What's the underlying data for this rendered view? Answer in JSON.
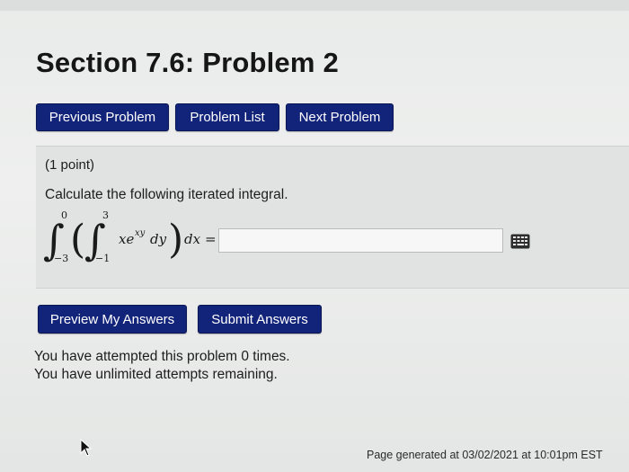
{
  "page": {
    "title": "Section 7.6: Problem 2"
  },
  "nav": {
    "previous": "Previous Problem",
    "list": "Problem List",
    "next": "Next Problem"
  },
  "problem": {
    "points": "(1 point)",
    "prompt": "Calculate the following iterated integral.",
    "integral": {
      "outer_upper": "0",
      "outer_lower": "−3",
      "inner_upper": "3",
      "inner_lower": "−1",
      "integrand": "xe",
      "exponent": "xy",
      "inner_diff": "dy",
      "outer_diff": "dx",
      "equals": "="
    },
    "answer_value": "",
    "equation_editor_icon": "keyboard-icon"
  },
  "actions": {
    "preview": "Preview My Answers",
    "submit": "Submit Answers"
  },
  "status": {
    "attempts": "You have attempted this problem 0 times.",
    "remaining": "You have unlimited attempts remaining."
  },
  "footer": {
    "generated": "Page generated at 03/02/2021 at 10:01pm EST"
  },
  "colors": {
    "button_bg": "#12237a",
    "button_text": "#ffffff"
  }
}
